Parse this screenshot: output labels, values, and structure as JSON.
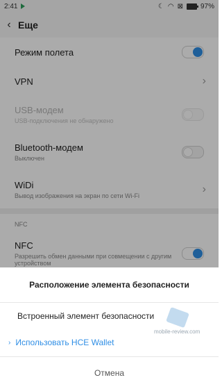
{
  "statusbar": {
    "time": "2:41",
    "battery": "97%",
    "battery_level": 0.97
  },
  "header": {
    "title": "Еще"
  },
  "rows": {
    "airplane": {
      "label": "Режим полета",
      "toggle": "on"
    },
    "vpn": {
      "label": "VPN"
    },
    "usb": {
      "label": "USB-модем",
      "sub": "USB-подключения не обнаружено",
      "toggle": "off",
      "disabled": true
    },
    "bluetooth": {
      "label": "Bluetooth-модем",
      "sub": "Выключен",
      "toggle": "off"
    },
    "widi": {
      "label": "WiDi",
      "sub": "Вывод изображения на экран по сети Wi-Fi"
    },
    "nfc_section": "NFC",
    "nfc": {
      "label": "NFC",
      "sub": "Разрешить обмен данными при совмещении с другим устройством",
      "toggle": "on"
    }
  },
  "dialog": {
    "title": "Расположение элемента безопасности",
    "options": [
      "Встроенный элемент безопасности",
      "Использовать HCE Wallet"
    ],
    "selected": 1,
    "cancel": "Отмена"
  },
  "watermark": {
    "text": "mobile-review.com"
  },
  "colors": {
    "accent": "#2f8ee5",
    "header_bg": "#f7f7f7"
  }
}
